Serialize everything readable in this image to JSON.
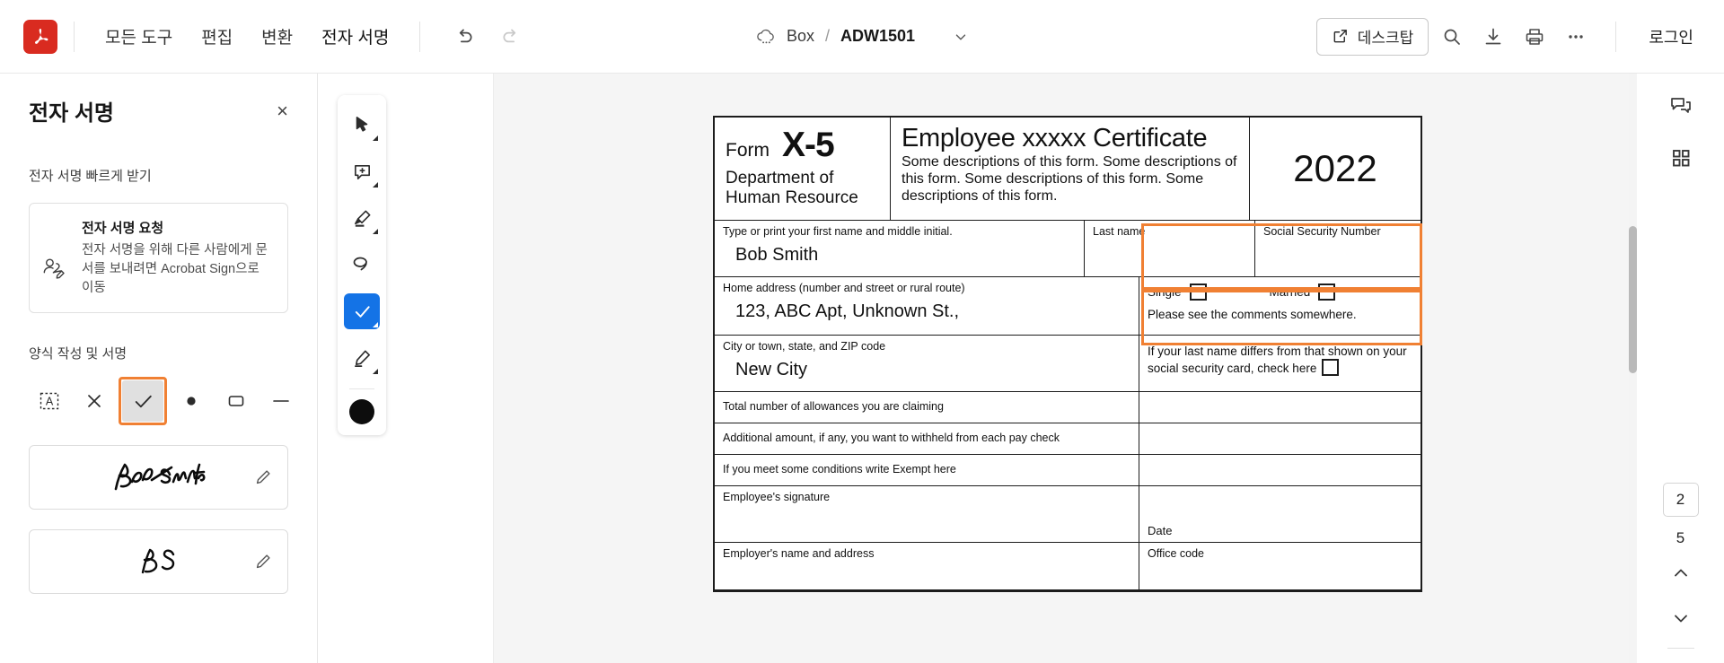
{
  "app": {
    "logo": "acrobat-logo",
    "menu": [
      {
        "label": "모든 도구",
        "name": "all-tools"
      },
      {
        "label": "편집",
        "name": "edit"
      },
      {
        "label": "변환",
        "name": "convert"
      },
      {
        "label": "전자 서명",
        "name": "e-sign"
      }
    ],
    "undo": "undo-icon",
    "redo": "redo-icon"
  },
  "breadcrumb": {
    "cloud_icon": "cloud-icon",
    "root": "Box",
    "separator": "/",
    "file": "ADW1501",
    "chevron": "chevron-down-icon"
  },
  "top_right": {
    "desktop_label": "데스크탑",
    "desktop_icon": "external-link-icon",
    "search_icon": "search-icon",
    "download_icon": "download-icon",
    "print_icon": "print-icon",
    "more_icon": "more-horizontal-icon",
    "login_label": "로그인"
  },
  "left_panel": {
    "title": "전자 서명",
    "close": "×",
    "section1_label": "전자 서명 빠르게 받기",
    "request_card": {
      "icon": "request-signature-icon",
      "title": "전자 서명 요청",
      "desc": "전자 서명을 위해 다른 사람에게 문서를 보내려면 Acrobat Sign으로 이동"
    },
    "section2_label": "양식 작성 및 서명",
    "tools": [
      {
        "name": "add-text-icon",
        "label": "A"
      },
      {
        "name": "cross-mark-icon",
        "label": "X"
      },
      {
        "name": "check-mark-icon",
        "label": "✓",
        "selected": true
      },
      {
        "name": "dot-icon",
        "label": "●"
      },
      {
        "name": "rectangle-icon",
        "label": "▭"
      },
      {
        "name": "line-icon",
        "label": "—"
      }
    ],
    "signatures": [
      {
        "name": "signature-bob-smith",
        "text": "Bob Smith",
        "edit_icon": "pencil-icon"
      },
      {
        "name": "initials-bs",
        "text": "BS",
        "edit_icon": "pencil-icon"
      }
    ]
  },
  "vertical_toolbar": {
    "items": [
      {
        "name": "select-tool",
        "icon": "cursor-icon",
        "active": false,
        "has_caret": true
      },
      {
        "name": "add-comment-tool",
        "icon": "comment-add-icon",
        "active": false,
        "has_caret": true
      },
      {
        "name": "highlight-tool",
        "icon": "highlighter-icon",
        "active": false,
        "has_caret": true
      },
      {
        "name": "draw-oval-tool",
        "icon": "oval-icon",
        "active": false,
        "has_caret": false
      },
      {
        "name": "fill-and-sign-tool",
        "icon": "check-icon",
        "active": true,
        "has_caret": true
      },
      {
        "name": "sign-tool",
        "icon": "sign-pen-icon",
        "active": false,
        "has_caret": true
      }
    ],
    "color_swatch": "#0d0d0d"
  },
  "right_rail": {
    "comment_icon": "comment-icon",
    "thumbnails_icon": "thumbnails-grid-icon",
    "current_page": "2",
    "total_pages": "5",
    "prev_icon": "chevron-up-icon",
    "next_icon": "chevron-down-icon"
  },
  "document": {
    "header": {
      "form_word": "Form",
      "form_code": "X-5",
      "department": "Department of\nHuman Resource",
      "title": "Employee xxxxx Certificate",
      "description": "Some descriptions of this form. Some descriptions of this form. Some descriptions of this form. Some descriptions of this form.",
      "year": "2022"
    },
    "rows": {
      "first_name_label": "Type or print your first name and middle initial.",
      "first_name_value": "Bob Smith",
      "last_name_label": "Last name",
      "last_name_value": "",
      "ssn_label": "Social Security Number",
      "ssn_value": "",
      "address_label": "Home address (number and street or rural route)",
      "address_value": "123, ABC Apt, Unknown St.,",
      "single_label": "Single",
      "married_label": "Married",
      "comments_note": "Please see the comments somewhere.",
      "city_label": "City or town, state, and ZIP code",
      "city_value": "New City",
      "last_name_differs": "If your last name differs from that shown on your social security card, check here",
      "allowances_label": "Total number of allowances you are claiming",
      "allowances_value": "",
      "additional_label": "Additional amount, if any, you want to withheld from each pay check",
      "additional_value": "",
      "exempt_label": "If you meet some conditions write Exempt here",
      "exempt_value": "",
      "employee_signature_label": "Employee's signature",
      "date_label": "Date",
      "employer_label": "Employer's name and address",
      "office_code_label": "Office code"
    },
    "highlight_color": "#f08033"
  }
}
